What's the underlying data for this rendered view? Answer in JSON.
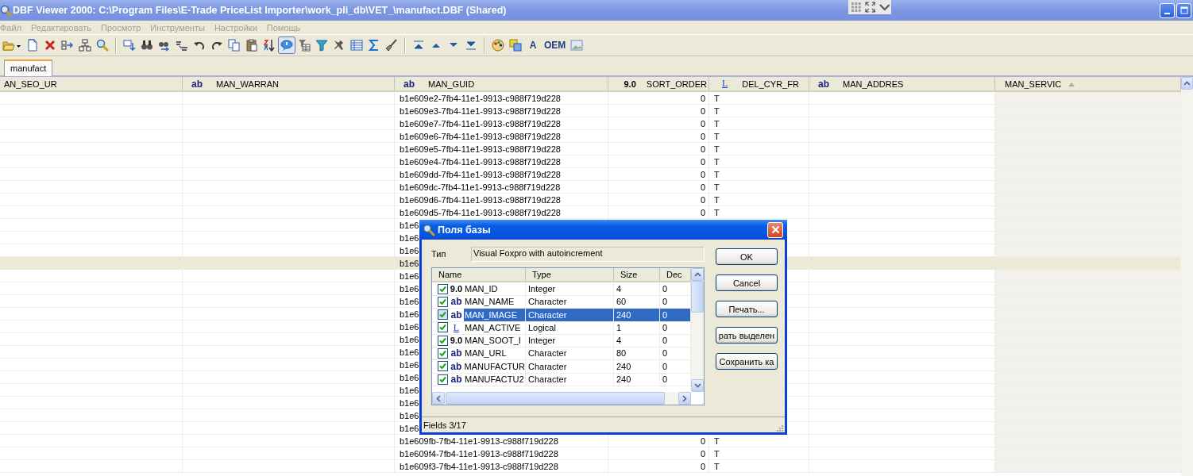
{
  "window": {
    "title": "DBF Viewer 2000: C:\\Program Files\\E-Trade PriceList Importer\\work_pli_db\\VET_\\manufact.DBF (Shared)"
  },
  "menu": [
    {
      "label": "Файл",
      "disabled": true
    },
    {
      "label": "Редактировать",
      "disabled": true
    },
    {
      "label": "Просмотр",
      "disabled": true
    },
    {
      "label": "Инструменты",
      "disabled": true
    },
    {
      "label": "Настройки",
      "disabled": true
    },
    {
      "label": "Помощь",
      "disabled": true
    }
  ],
  "toolbar": {
    "groups": [
      {
        "buttons": [
          {
            "pressed": false
          },
          {
            "pressed": false
          },
          {
            "pressed": false
          },
          {
            "pressed": false
          },
          {
            "pressed": false
          },
          {
            "pressed": false
          }
        ]
      },
      {
        "buttons": [
          {
            "pressed": false
          },
          {
            "pressed": false
          },
          {
            "pressed": false
          },
          {
            "pressed": false
          },
          {
            "pressed": false
          },
          {
            "pressed": false
          },
          {
            "pressed": false
          },
          {
            "pressed": false
          },
          {
            "pressed": false
          },
          {
            "pressed": true
          },
          {
            "pressed": false
          },
          {
            "pressed": false
          },
          {
            "pressed": false
          },
          {
            "pressed": false
          },
          {
            "pressed": false
          },
          {
            "pressed": false
          }
        ]
      },
      {
        "buttons": [
          {
            "pressed": false
          },
          {
            "pressed": false
          },
          {
            "pressed": false
          },
          {
            "pressed": false
          }
        ]
      },
      {
        "buttons": [
          {
            "pressed": false
          },
          {
            "pressed": false
          },
          {
            "label": "A",
            "pressed": false
          },
          {
            "label": "OEM",
            "pressed": false
          },
          {
            "pressed": false
          }
        ]
      }
    ]
  },
  "tabs": [
    {
      "label": "manufact",
      "selected": true
    }
  ],
  "grid": {
    "columns": [
      {
        "kind": "plain",
        "name": "AN_SEO_UR"
      },
      {
        "kind": "char",
        "type_label": "ab",
        "name": "MAN_WARRAN"
      },
      {
        "kind": "char",
        "type_label": "ab",
        "name": "MAN_GUID"
      },
      {
        "kind": "num",
        "type_label": "9.0",
        "name": "SORT_ORDER"
      },
      {
        "kind": "logical",
        "type_label": "L",
        "name": "DEL_CYR_FR"
      },
      {
        "kind": "char",
        "type_label": "ab",
        "name": "MAN_ADDRES"
      },
      {
        "kind": "plain",
        "name": "MAN_SERVIC",
        "sort_ascending": true
      }
    ],
    "rows": [
      {
        "selected": false,
        "man_guid": "b1e609e2-7fb4-11e1-9913-c988f719d228",
        "sort_order": "0",
        "del_cyr_fr": "T"
      },
      {
        "selected": false,
        "man_guid": "b1e609e3-7fb4-11e1-9913-c988f719d228",
        "sort_order": "0",
        "del_cyr_fr": "T"
      },
      {
        "selected": false,
        "man_guid": "b1e609e7-7fb4-11e1-9913-c988f719d228",
        "sort_order": "0",
        "del_cyr_fr": "T"
      },
      {
        "selected": false,
        "man_guid": "b1e609e6-7fb4-11e1-9913-c988f719d228",
        "sort_order": "0",
        "del_cyr_fr": "T"
      },
      {
        "selected": false,
        "man_guid": "b1e609e5-7fb4-11e1-9913-c988f719d228",
        "sort_order": "0",
        "del_cyr_fr": "T"
      },
      {
        "selected": false,
        "man_guid": "b1e609e4-7fb4-11e1-9913-c988f719d228",
        "sort_order": "0",
        "del_cyr_fr": "T"
      },
      {
        "selected": false,
        "man_guid": "b1e609dd-7fb4-11e1-9913-c988f719d228",
        "sort_order": "0",
        "del_cyr_fr": "T"
      },
      {
        "selected": false,
        "man_guid": "b1e609dc-7fb4-11e1-9913-c988f719d228",
        "sort_order": "0",
        "del_cyr_fr": "T"
      },
      {
        "selected": false,
        "man_guid": "b1e609d6-7fb4-11e1-9913-c988f719d228",
        "sort_order": "0",
        "del_cyr_fr": "T"
      },
      {
        "selected": false,
        "man_guid": "b1e609d5-7fb4-11e1-9913-c988f719d228",
        "sort_order": "0",
        "del_cyr_fr": "T"
      },
      {
        "selected": false,
        "man_guid": "b1e6"
      },
      {
        "selected": false,
        "man_guid": "b1e6"
      },
      {
        "selected": false,
        "man_guid": "b1e6"
      },
      {
        "selected": true,
        "man_guid": "b1e6"
      },
      {
        "selected": false,
        "man_guid": "b1e6"
      },
      {
        "selected": false,
        "man_guid": "b1e6"
      },
      {
        "selected": false,
        "man_guid": "b1e6"
      },
      {
        "selected": false,
        "man_guid": "b1e6"
      },
      {
        "selected": false,
        "man_guid": "b1e6"
      },
      {
        "selected": false,
        "man_guid": "b1e6"
      },
      {
        "selected": false,
        "man_guid": "b1e6"
      },
      {
        "selected": false,
        "man_guid": "b1e6"
      },
      {
        "selected": false,
        "man_guid": "b1e6"
      },
      {
        "selected": false,
        "man_guid": "b1e6"
      },
      {
        "selected": false,
        "man_guid": "b1e6"
      },
      {
        "selected": false,
        "man_guid": "b1e6"
      },
      {
        "selected": false,
        "man_guid": "b1e6"
      },
      {
        "selected": false,
        "man_guid": "b1e609fb-7fb4-11e1-9913-c988f719d228",
        "sort_order": "0",
        "del_cyr_fr": "T"
      },
      {
        "selected": false,
        "man_guid": "b1e609f4-7fb4-11e1-9913-c988f719d228",
        "sort_order": "0",
        "del_cyr_fr": "T"
      },
      {
        "selected": false,
        "man_guid": "b1e609f3-7fb4-11e1-9913-c988f719d228",
        "sort_order": "0",
        "del_cyr_fr": "T"
      }
    ]
  },
  "dialog": {
    "title": "Поля базы",
    "type_label": "Тип",
    "type_value": "Visual Foxpro with autoincrement",
    "fields_table": {
      "columns": [
        "Name",
        "Type",
        "Size",
        "Dec"
      ],
      "rows": [
        {
          "checked": true,
          "kind": "num",
          "type_label": "9.0",
          "name": "MAN_ID",
          "type": "Integer",
          "size": "4",
          "dec": "0",
          "selected": false
        },
        {
          "checked": true,
          "kind": "char",
          "type_label": "ab",
          "name": "MAN_NAME",
          "type": "Character",
          "size": "60",
          "dec": "0",
          "selected": false
        },
        {
          "checked": true,
          "kind": "char",
          "type_label": "ab",
          "name": "MAN_IMAGE",
          "type": "Character",
          "size": "240",
          "dec": "0",
          "selected": true
        },
        {
          "checked": true,
          "kind": "logical",
          "type_label": "L",
          "name": "MAN_ACTIVE",
          "type": "Logical",
          "size": "1",
          "dec": "0",
          "selected": false
        },
        {
          "checked": true,
          "kind": "num",
          "type_label": "9.0",
          "name": "MAN_SOOT_I",
          "type": "Integer",
          "size": "4",
          "dec": "0",
          "selected": false
        },
        {
          "checked": true,
          "kind": "char",
          "type_label": "ab",
          "name": "MAN_URL",
          "type": "Character",
          "size": "80",
          "dec": "0",
          "selected": false
        },
        {
          "checked": true,
          "kind": "char",
          "type_label": "ab",
          "name": "MANUFACTUR",
          "type": "Character",
          "size": "240",
          "dec": "0",
          "selected": false
        },
        {
          "checked": true,
          "kind": "char",
          "type_label": "ab",
          "name": "MANUFACTU2",
          "type": "Character",
          "size": "240",
          "dec": "0",
          "selected": false
        }
      ]
    },
    "buttons": [
      "OK",
      "Cancel",
      "Печать...",
      "рать выделен",
      "Сохранить ка"
    ],
    "status": "Fields 3/17"
  }
}
